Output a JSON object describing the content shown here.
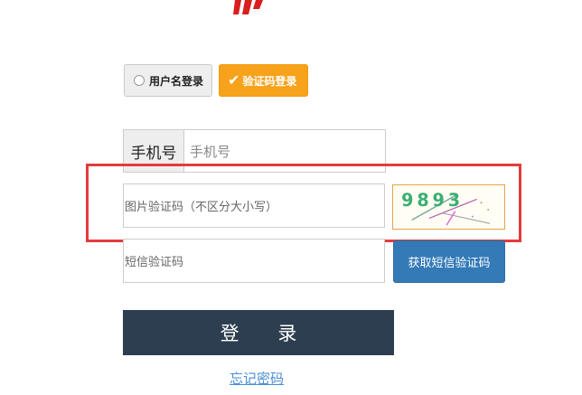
{
  "login_mode": {
    "username_label": "用户名登录",
    "sms_label": "验证码登录",
    "selected": "sms"
  },
  "phone": {
    "prefix_label": "手机号",
    "placeholder": "手机号"
  },
  "captcha": {
    "placeholder": "图片验证码（不区分大小写）",
    "code_text": "9893"
  },
  "sms_code": {
    "placeholder": "短信验证码",
    "button_label": "获取短信验证码"
  },
  "login_button_label": "登 录",
  "forgot_password_label": "忘记密码",
  "colors": {
    "accent_orange": "#f7a21b",
    "button_blue": "#337ab7",
    "login_dark": "#2d3e50",
    "highlight_red": "#e53b3b",
    "link_blue": "#4a8ed6"
  }
}
